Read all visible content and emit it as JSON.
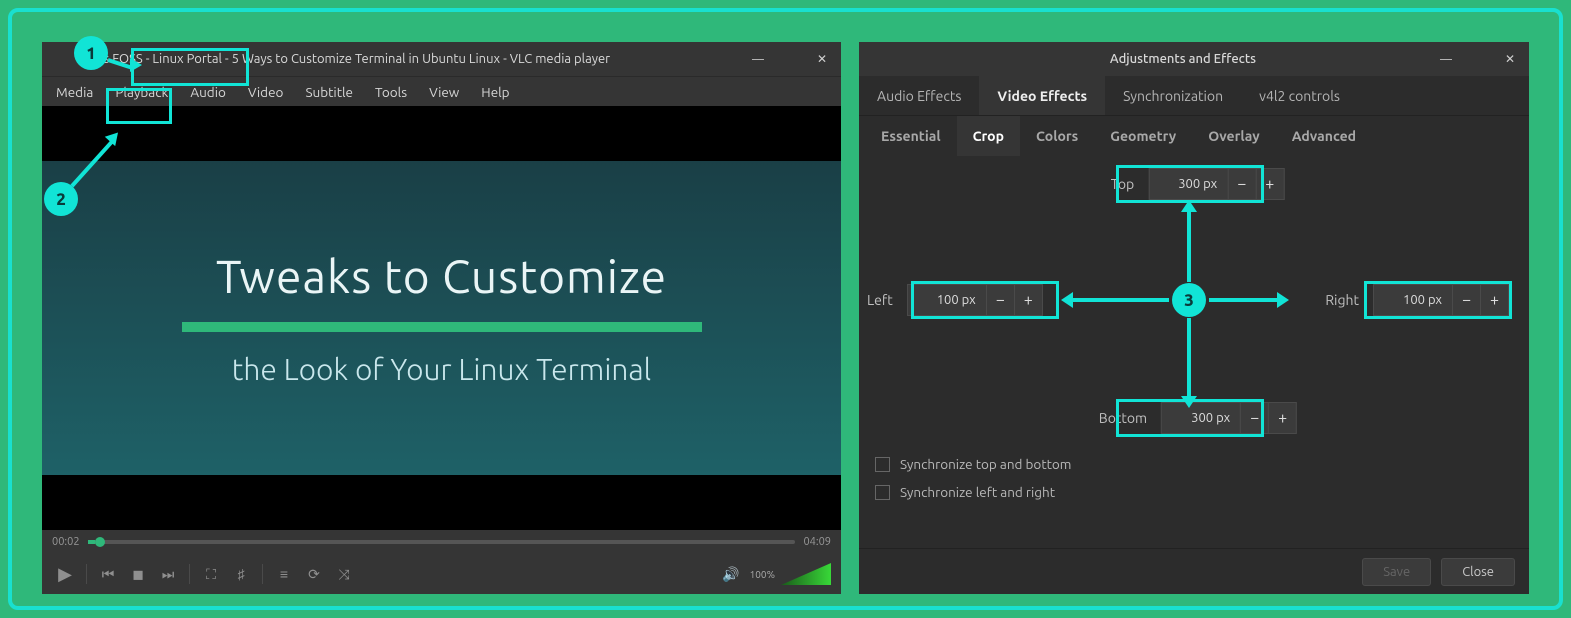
{
  "vlc": {
    "title": "It's FOSS - Linux Portal - 5 Ways to Customize Terminal in Ubuntu Linux - VLC media player",
    "menu": [
      "Media",
      "Playback",
      "Audio",
      "Video",
      "Subtitle",
      "Tools",
      "View",
      "Help"
    ],
    "slide_h1": "Tweaks to Customize",
    "slide_h2": "the Look of Your Linux Terminal",
    "time_cur": "00:02",
    "time_tot": "04:09",
    "vol_pct": "100%"
  },
  "effects": {
    "title": "Adjustments and Effects",
    "tabs": [
      "Audio Effects",
      "Video Effects",
      "Synchronization",
      "v4l2 controls"
    ],
    "active_tab": 1,
    "subtabs": [
      "Essential",
      "Crop",
      "Colors",
      "Geometry",
      "Overlay",
      "Advanced"
    ],
    "active_sub": 1,
    "crop": {
      "top_label": "Top",
      "top_val": "300 px",
      "left_label": "Left",
      "left_val": "100 px",
      "right_label": "Right",
      "right_val": "100 px",
      "bottom_label": "Bottom",
      "bottom_val": "300 px"
    },
    "check1": "Synchronize top and bottom",
    "check2": "Synchronize left and right",
    "save": "Save",
    "close": "Close"
  },
  "annot": {
    "b1": "1",
    "b2": "2",
    "b3": "3"
  }
}
